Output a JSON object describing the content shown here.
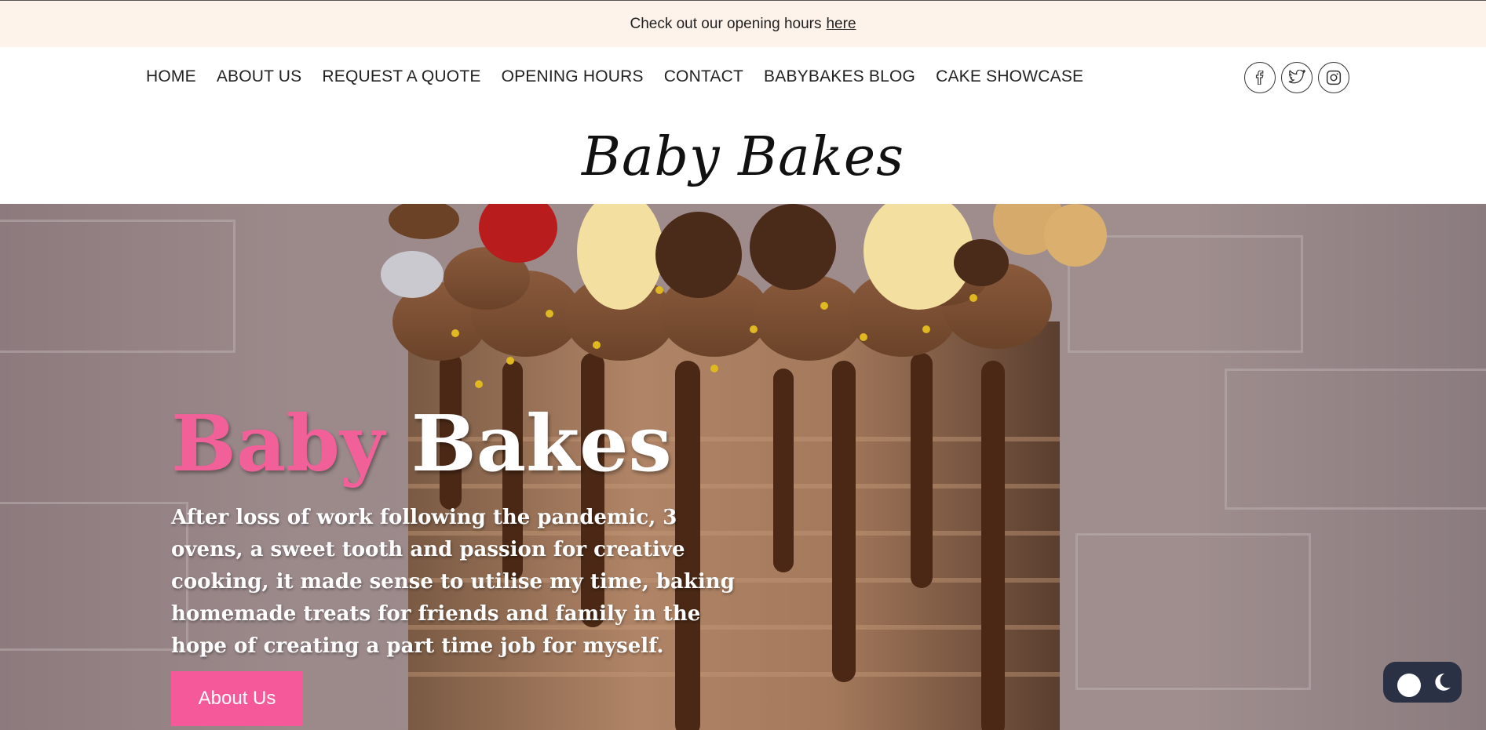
{
  "announcement": {
    "text": "Check out our opening hours",
    "link": "here"
  },
  "nav": [
    "HOME",
    "ABOUT US",
    "REQUEST A QUOTE",
    "OPENING HOURS",
    "CONTACT",
    "BABYBAKES BLOG",
    "CAKE SHOWCASE"
  ],
  "social_icons": [
    "facebook-icon",
    "twitter-icon",
    "instagram-icon"
  ],
  "brand": {
    "logo_text": "Baby Bakes"
  },
  "hero": {
    "title_pink": "Baby",
    "title_white": "Bakes",
    "body": "After loss of work following the pandemic, 3 ovens, a sweet tooth and passion for creative cooking, it made sense to utilise my time, baking homemade treats for friends and family in the hope of creating a part time job for myself.",
    "button": "About Us"
  },
  "colors": {
    "accent_pink": "#f6599a",
    "announce_bg": "#fdf3ea",
    "toggle_bg": "#2a3144"
  },
  "theme_toggle": {
    "state": "light"
  }
}
